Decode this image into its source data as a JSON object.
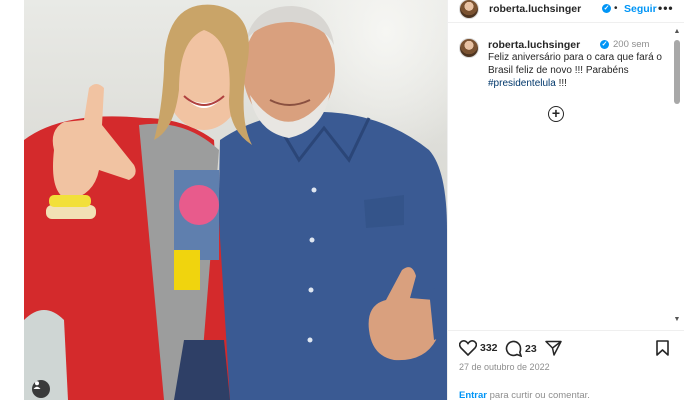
{
  "post": {
    "photo_description_icon": "user-tag-icon",
    "header": {
      "username": "roberta.luchsinger",
      "verified": true,
      "separator": "•",
      "follow_label": "Seguir",
      "more_icon": "more-options-icon",
      "more_label": "•••"
    },
    "caption": {
      "username": "roberta.luchsinger",
      "time_ago": "200 sem",
      "text": "Feliz aniversário para o cara que fará o Brasil feliz de novo !!! Parabéns ",
      "hashtag": "#presidentelula",
      "suffix": " !!!"
    },
    "load_more_icon": "plus-circle-icon",
    "load_more_label": "+",
    "actions": {
      "like_icon": "heart-icon",
      "like_count": "332",
      "comment_icon": "comment-icon",
      "comment_count": "23",
      "share_icon": "share-icon",
      "save_icon": "bookmark-icon"
    },
    "date": "27 de outubro de 2022",
    "login_prompt": {
      "link": "Entrar",
      "text": " para curtir ou comentar."
    }
  },
  "colors": {
    "accent": "#0095f6",
    "hashtag": "#00376b",
    "muted": "#8e8e8e",
    "text": "#262626",
    "jacket": "#d42a2c",
    "shirt": "#3a5a93"
  }
}
